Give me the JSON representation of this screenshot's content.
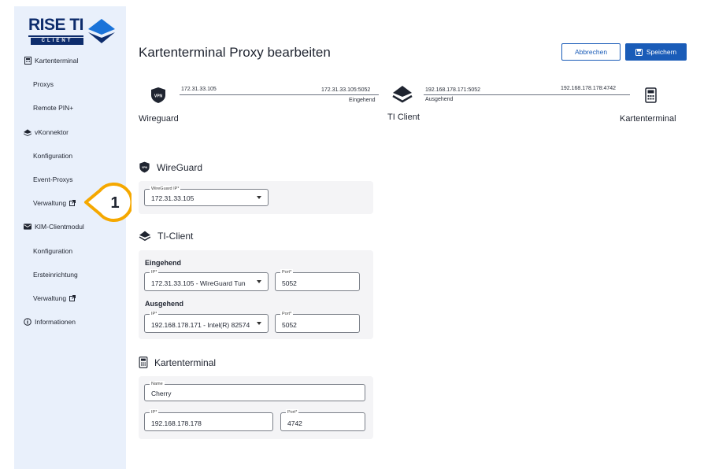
{
  "logo": {
    "brand": "RISE TI",
    "sub": "CLIENT"
  },
  "sidebar": {
    "items": [
      {
        "label": "Kartenterminal"
      },
      {
        "label": "Proxys"
      },
      {
        "label": "Remote PIN+"
      },
      {
        "label": "vKonnektor"
      },
      {
        "label": "Konfiguration"
      },
      {
        "label": "Event-Proxys"
      },
      {
        "label": "Verwaltung"
      },
      {
        "label": "KIM-Clientmodul"
      },
      {
        "label": "Konfiguration"
      },
      {
        "label": "Ersteinrichtung"
      },
      {
        "label": "Verwaltung"
      },
      {
        "label": "Informationen"
      }
    ]
  },
  "callout": {
    "number": "1",
    "color": "#f5a800"
  },
  "header": {
    "title": "Kartenterminal Proxy bearbeiten",
    "cancel_label": "Abbrechen",
    "save_label": "Speichern"
  },
  "diagram": {
    "wg_ip": "172.31.33.105",
    "wg_endpoint": "172.31.33.105:5052",
    "incoming": "Eingehend",
    "ti_endpoint": "192.168.178.171:5052",
    "outgoing": "Ausgehend",
    "kt_endpoint": "192.168.178.178:4742",
    "wg_label": "Wireguard",
    "ti_label": "TI Client",
    "kt_label": "Kartenterminal",
    "vpn_badge": "VPN"
  },
  "wireguard": {
    "title": "WireGuard",
    "ip_label": "WireGuard IP*",
    "ip_value": "172.31.33.105"
  },
  "ticlient": {
    "title": "TI-Client",
    "incoming_title": "Eingehend",
    "incoming_ip_label": "IP*",
    "incoming_ip_value": "172.31.33.105 - WireGuard Tun",
    "incoming_port_label": "Port*",
    "incoming_port_value": "5052",
    "outgoing_title": "Ausgehend",
    "outgoing_ip_label": "IP*",
    "outgoing_ip_value": "192.168.178.171 - Intel(R) 82574",
    "outgoing_port_label": "Port*",
    "outgoing_port_value": "5052"
  },
  "terminal": {
    "title": "Kartenterminal",
    "name_label": "Name",
    "name_value": "Cherry",
    "ip_label": "IP*",
    "ip_value": "192.168.178.178",
    "port_label": "Port*",
    "port_value": "4742"
  },
  "colors": {
    "brand": "#0d2c6c",
    "accent": "#1a5cb8",
    "sidebar": "#e9f0fb"
  }
}
